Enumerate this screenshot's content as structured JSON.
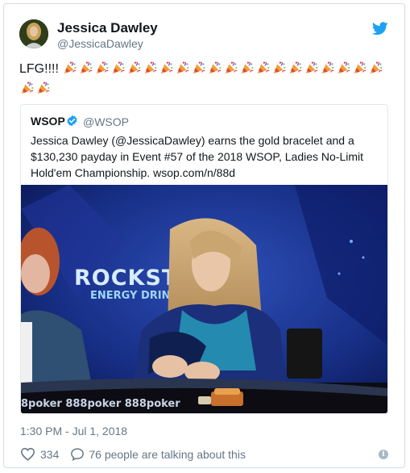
{
  "author": {
    "display_name": "Jessica Dawley",
    "handle": "@JessicaDawley"
  },
  "tweet": {
    "text": "LFG!!!!",
    "emoji_sequence": [
      "party-popper",
      "party-popper",
      "party-popper",
      "party-popper",
      "party-popper",
      "party-popper",
      "party-popper",
      "party-popper",
      "party-popper",
      "party-popper",
      "party-popper",
      "party-popper",
      "party-popper",
      "party-popper",
      "party-popper",
      "party-popper",
      "party-popper",
      "party-popper",
      "party-popper",
      "party-popper",
      "party-popper",
      "party-popper"
    ]
  },
  "quoted_tweet": {
    "display_name": "WSOP",
    "handle": "@WSOP",
    "text": "Jessica Dawley (@JessicaDawley) earns the gold bracelet and a $130,230 payday in Event #57 of the 2018 WSOP, Ladies No-Limit Hold'em Championship. wsop.com/n/88d",
    "photo": {
      "sign_text": "ROCKSTAR",
      "sign_subtext": "ENERGY DRINK",
      "table_text": "8poker 888poker 888poker"
    }
  },
  "timestamp": "1:30 PM - Jul 1, 2018",
  "actions": {
    "like_count": "334",
    "talking_text": "76 people are talking about this"
  },
  "icons": {
    "twitter": "twitter-bird-icon",
    "verified": "verified-badge-icon",
    "like": "heart-icon",
    "reply": "speech-bubble-icon",
    "info": "info-icon"
  },
  "colors": {
    "twitter_blue": "#1da1f2",
    "secondary_text": "#657786",
    "border": "#e1e8ed"
  }
}
